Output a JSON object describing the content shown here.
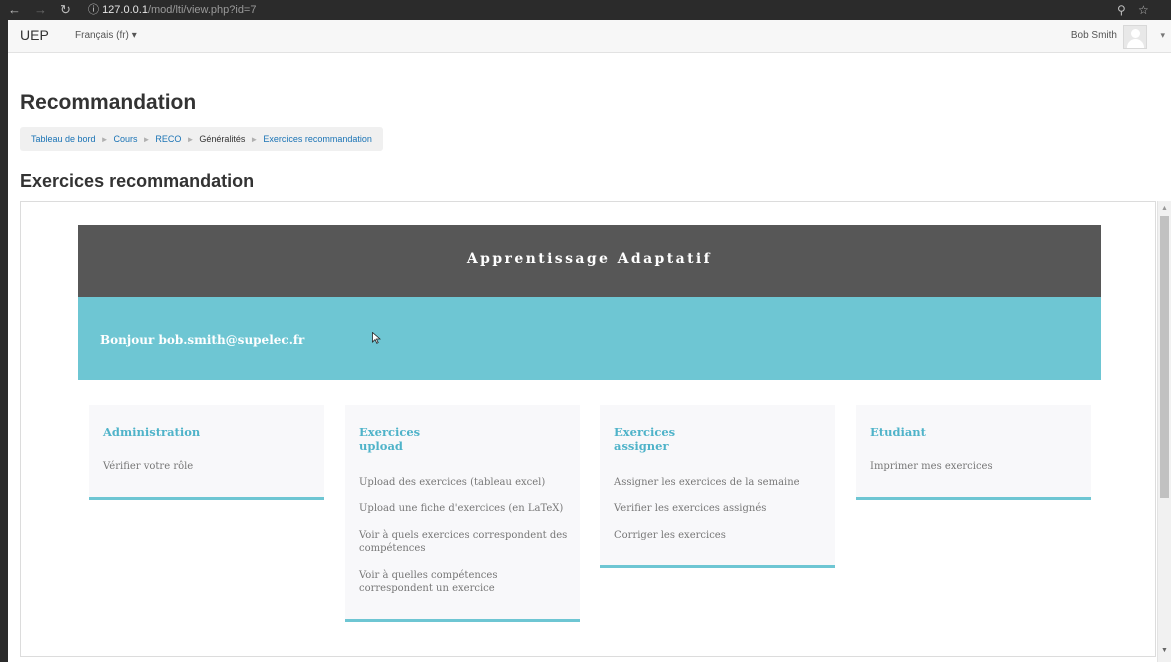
{
  "browser": {
    "url_host": "127.0.0.1",
    "url_path": "/mod/lti/view.php?id=7"
  },
  "topnav": {
    "brand": "UEP",
    "language": "Français (fr)",
    "language_caret": "▾",
    "user_name": "Bob Smith",
    "user_caret": "▾"
  },
  "page": {
    "title": "Recommandation",
    "activity_title": "Exercices recommandation",
    "breadcrumb_separator": "►",
    "breadcrumb": [
      {
        "label": "Tableau de bord"
      },
      {
        "label": "Cours"
      },
      {
        "label": "RECO"
      },
      {
        "label": "Généralités"
      },
      {
        "label": "Exercices recommandation"
      }
    ]
  },
  "tool": {
    "banner_title": "Apprentissage Adaptatif",
    "welcome": "Bonjour bob.smith@supelec.fr",
    "cards": [
      {
        "title": "Administration",
        "links": [
          "Vérifier votre rôle"
        ]
      },
      {
        "title_line1": "Exercices",
        "title_line2": "upload",
        "links": [
          "Upload des exercices (tableau excel)",
          "Upload une fiche d'exercices (en LaTeX)",
          "Voir à quels exercices correspondent des compétences",
          "Voir à quelles compétences correspondent un exercice"
        ]
      },
      {
        "title_line1": "Exercices",
        "title_line2": "assigner",
        "links": [
          "Assigner les exercices de la semaine",
          "Verifier les exercices assignés",
          "Corriger les exercices"
        ]
      },
      {
        "title": "Etudiant",
        "links": [
          "Imprimer mes exercices"
        ]
      }
    ]
  },
  "colors": {
    "banner": "#575757",
    "accent_teal": "#6ec6d3",
    "card_title": "#4fb3c9",
    "link_blue": "#1a73b5"
  },
  "icons": {
    "back": "back-arrow-icon",
    "forward": "forward-arrow-icon",
    "reload": "reload-icon",
    "info": "info-icon",
    "zoom": "zoom-icon",
    "bookmark": "star-icon",
    "avatar": "user-avatar-icon",
    "cursor": "mouse-cursor-icon"
  }
}
